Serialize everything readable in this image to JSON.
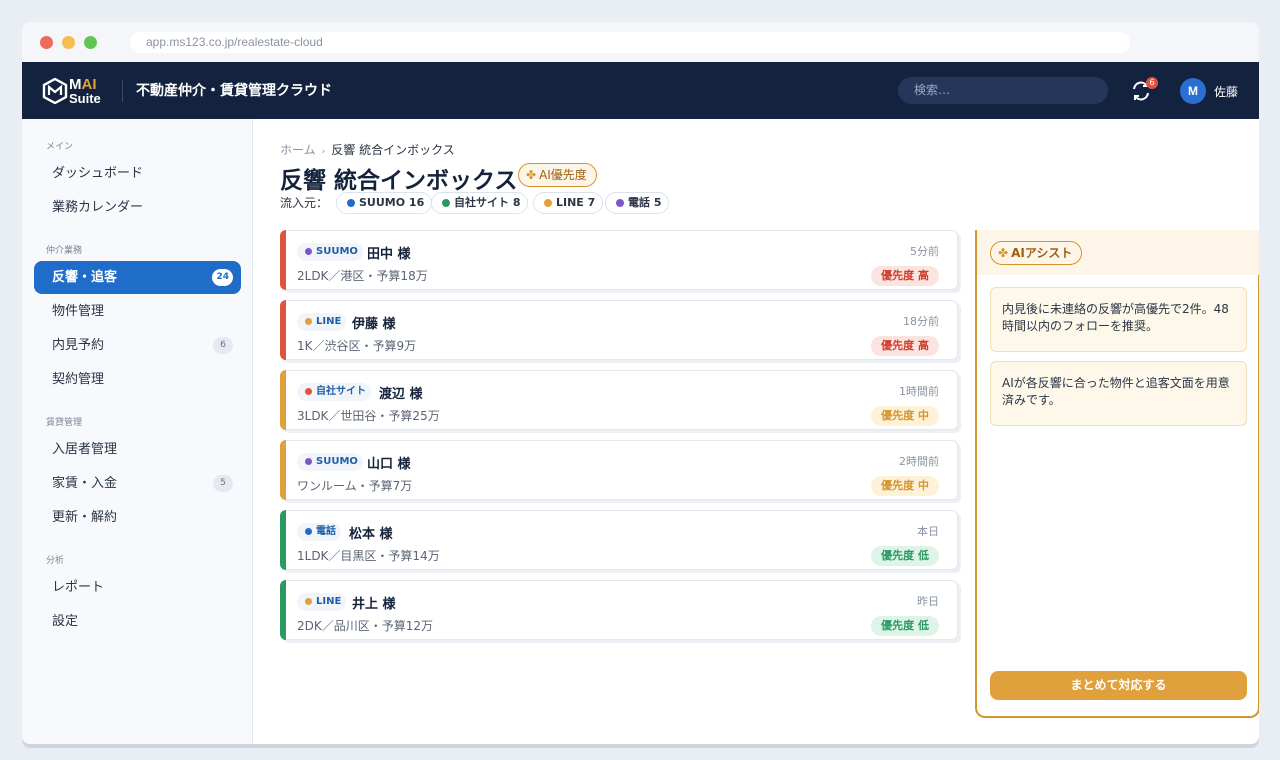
{
  "browser": {
    "url": "app.ms123.co.jp/realestate-cloud"
  },
  "header": {
    "logo_m": "M",
    "logo_ai": "AI",
    "logo_suite": "Suite",
    "app_title": "不動産仲介・賃貸管理クラウド",
    "search_placeholder": "検索…",
    "notification_count": "6",
    "avatar_initial": "M",
    "user_name": "佐藤"
  },
  "sidebar": {
    "sections": [
      {
        "title": "メイン",
        "items": [
          {
            "label": "ダッシュボード"
          },
          {
            "label": "業務カレンダー"
          }
        ]
      },
      {
        "title": "仲介業務",
        "items": [
          {
            "label": "反響・追客",
            "count": "24",
            "active": true
          },
          {
            "label": "物件管理"
          },
          {
            "label": "内見予約",
            "count": "6"
          },
          {
            "label": "契約管理"
          }
        ]
      },
      {
        "title": "賃貸管理",
        "items": [
          {
            "label": "入居者管理"
          },
          {
            "label": "家賃・入金",
            "count": "5"
          },
          {
            "label": "更新・解約"
          }
        ]
      },
      {
        "title": "分析",
        "items": [
          {
            "label": "レポート"
          },
          {
            "label": "設定"
          }
        ]
      }
    ]
  },
  "main": {
    "breadcrumb": {
      "home": "ホーム",
      "separator": "›",
      "current": "反響 統合インボックス"
    },
    "title": "反響 統合インボックス",
    "ai_badge": "AI優先度",
    "sources_label": "流入元：",
    "sources": [
      {
        "label": "SUUMO 16",
        "color": "#1f6cc9"
      },
      {
        "label": "自社サイト 8",
        "color": "#2b9a62"
      },
      {
        "label": "LINE 7",
        "color": "#e0a03c"
      },
      {
        "label": "電話 5",
        "color": "#7b55c9"
      }
    ],
    "inquiries": [
      {
        "source": "SUUMO",
        "source_color": "#7b55c9",
        "name": "田中 様",
        "details": "2LDK／港区・予算18万",
        "time": "5分前",
        "priority": "優先度 高",
        "level": "high",
        "bar_color": "#e0533e"
      },
      {
        "source": "LINE",
        "source_color": "#e0a03c",
        "name": "伊藤 様",
        "details": "1K／渋谷区・予算9万",
        "time": "18分前",
        "priority": "優先度 高",
        "level": "high",
        "bar_color": "#e0533e"
      },
      {
        "source": "自社サイト",
        "source_color": "#e0533e",
        "name": "渡辺 様",
        "details": "3LDK／世田谷・予算25万",
        "time": "1時間前",
        "priority": "優先度 中",
        "level": "mid",
        "bar_color": "#e0a03c"
      },
      {
        "source": "SUUMO",
        "source_color": "#7b55c9",
        "name": "山口 様",
        "details": "ワンルーム・予算7万",
        "time": "2時間前",
        "priority": "優先度 中",
        "level": "mid",
        "bar_color": "#e0a03c"
      },
      {
        "source": "電話",
        "source_color": "#1f6cc9",
        "name": "松本 様",
        "details": "1LDK／目黒区・予算14万",
        "time": "本日",
        "priority": "優先度 低",
        "level": "low",
        "bar_color": "#2b9a62"
      },
      {
        "source": "LINE",
        "source_color": "#e0a03c",
        "name": "井上 様",
        "details": "2DK／品川区・予算12万",
        "time": "昨日",
        "priority": "優先度 低",
        "level": "low",
        "bar_color": "#2b9a62"
      }
    ]
  },
  "assist": {
    "title": "AIアシスト",
    "notes": [
      "内見後に未連絡の反響が高優先で2件。48時間以内のフォローを推奨。",
      "AIが各反響に合った物件と追客文面を用意済みです。"
    ],
    "action_label": "まとめて対応する"
  }
}
